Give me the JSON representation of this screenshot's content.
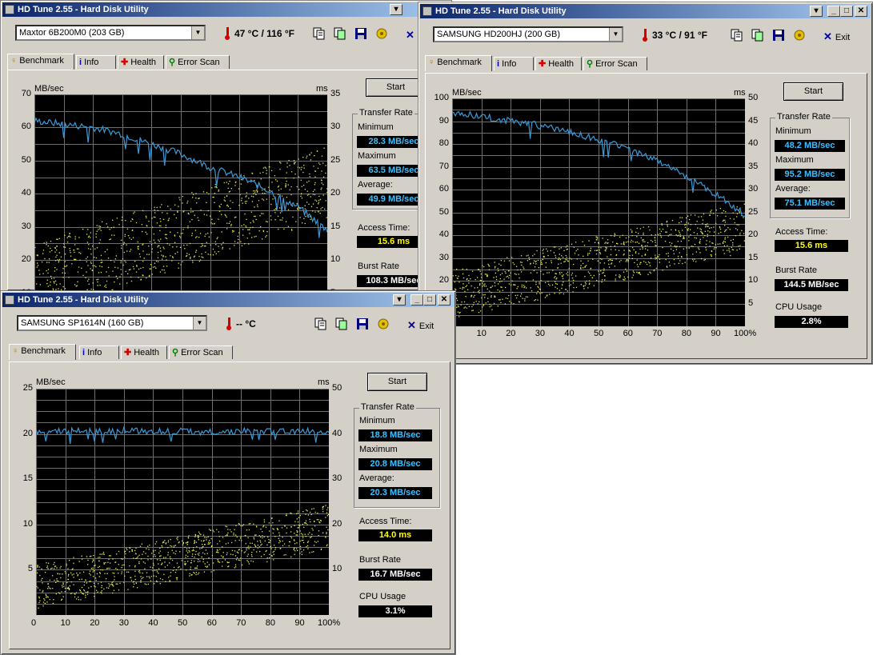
{
  "windows": [
    {
      "title": "HD Tune 2.55 - Hard Disk Utility",
      "drive": "Maxtor 6B200M0 (203 GB)",
      "temperature": "47 °C / 116 °F",
      "exit_label": "Exit",
      "tabs": [
        "Benchmark",
        "Info",
        "Health",
        "Error Scan"
      ],
      "start_label": "Start",
      "transfer_rate_label": "Transfer Rate",
      "minimum_label": "Minimum",
      "minimum": "28.3 MB/sec",
      "maximum_label": "Maximum",
      "maximum": "63.5 MB/sec",
      "average_label": "Average:",
      "average": "49.9 MB/sec",
      "access_time_label": "Access Time:",
      "access_time": "15.6 ms",
      "burst_rate_label": "Burst Rate",
      "burst_rate": "108.3 MB/sec",
      "y_unit_left": "MB/sec",
      "y_unit_right": "ms",
      "y_ticks_left": [
        "70",
        "60",
        "50",
        "40",
        "30",
        "20",
        "10"
      ],
      "y_ticks_right": [
        "35",
        "30",
        "25",
        "20",
        "15",
        "10",
        "5"
      ]
    },
    {
      "title": "HD Tune 2.55 - Hard Disk Utility",
      "drive": "SAMSUNG HD200HJ (200 GB)",
      "temperature": "33 °C / 91 °F",
      "exit_label": "Exit",
      "tabs": [
        "Benchmark",
        "Info",
        "Health",
        "Error Scan"
      ],
      "start_label": "Start",
      "transfer_rate_label": "Transfer Rate",
      "minimum_label": "Minimum",
      "minimum": "48.2 MB/sec",
      "maximum_label": "Maximum",
      "maximum": "95.2 MB/sec",
      "average_label": "Average:",
      "average": "75.1 MB/sec",
      "access_time_label": "Access Time:",
      "access_time": "15.6 ms",
      "burst_rate_label": "Burst Rate",
      "burst_rate": "144.5 MB/sec",
      "cpu_usage_label": "CPU Usage",
      "cpu_usage": "2.8%",
      "y_unit_left": "MB/sec",
      "y_unit_right": "ms",
      "y_ticks_left": [
        "100",
        "90",
        "80",
        "70",
        "60",
        "50",
        "40",
        "30",
        "20",
        "10"
      ],
      "y_ticks_right": [
        "50",
        "45",
        "40",
        "35",
        "30",
        "25",
        "20",
        "15",
        "10",
        "5"
      ],
      "x_ticks": [
        "10",
        "20",
        "30",
        "40",
        "50",
        "60",
        "70",
        "80",
        "90",
        "100%"
      ]
    },
    {
      "title": "HD Tune 2.55 - Hard Disk Utility",
      "drive": "SAMSUNG SP1614N (160 GB)",
      "temperature": "-- °C",
      "exit_label": "Exit",
      "tabs": [
        "Benchmark",
        "Info",
        "Health",
        "Error Scan"
      ],
      "start_label": "Start",
      "transfer_rate_label": "Transfer Rate",
      "minimum_label": "Minimum",
      "minimum": "18.8 MB/sec",
      "maximum_label": "Maximum",
      "maximum": "20.8 MB/sec",
      "average_label": "Average:",
      "average": "20.3 MB/sec",
      "access_time_label": "Access Time:",
      "access_time": "14.0 ms",
      "burst_rate_label": "Burst Rate",
      "burst_rate": "16.7 MB/sec",
      "cpu_usage_label": "CPU Usage",
      "cpu_usage": "3.1%",
      "y_unit_left": "MB/sec",
      "y_unit_right": "ms",
      "y_ticks_left": [
        "25",
        "20",
        "15",
        "10",
        "5"
      ],
      "y_ticks_right": [
        "50",
        "40",
        "30",
        "20",
        "10"
      ],
      "x_ticks": [
        "0",
        "10",
        "20",
        "30",
        "40",
        "50",
        "60",
        "70",
        "80",
        "90",
        "100%"
      ]
    }
  ],
  "chart_data": [
    {
      "type": "line",
      "drive": "Maxtor 6B200M0 (203 GB)",
      "y_unit_left": "MB/sec",
      "y_unit_right": "ms",
      "ylim_left": [
        0,
        70
      ],
      "ylim_right": [
        0,
        35
      ],
      "transfer_x": [
        0,
        10,
        20,
        30,
        40,
        50,
        60,
        70,
        80,
        90,
        100
      ],
      "transfer_y": [
        62,
        61,
        60,
        58,
        55,
        52,
        48,
        45,
        41,
        36,
        29
      ],
      "access_time_ms": 15.6,
      "grid": true
    },
    {
      "type": "line",
      "drive": "SAMSUNG HD200HJ (200 GB)",
      "y_unit_left": "MB/sec",
      "y_unit_right": "ms",
      "ylim_left": [
        0,
        100
      ],
      "ylim_right": [
        0,
        50
      ],
      "transfer_x": [
        0,
        10,
        20,
        30,
        40,
        50,
        60,
        70,
        80,
        90,
        100
      ],
      "transfer_y": [
        94,
        92,
        90,
        88,
        85,
        82,
        78,
        73,
        66,
        58,
        49
      ],
      "access_time_ms": 15.6,
      "grid": true
    },
    {
      "type": "line",
      "drive": "SAMSUNG SP1614N (160 GB)",
      "y_unit_left": "MB/sec",
      "y_unit_right": "ms",
      "ylim_left": [
        0,
        25
      ],
      "ylim_right": [
        0,
        50
      ],
      "transfer_x": [
        0,
        10,
        20,
        30,
        40,
        50,
        60,
        70,
        80,
        90,
        100
      ],
      "transfer_y": [
        20.3,
        20.3,
        20.3,
        20.4,
        20.3,
        20.3,
        20.2,
        20.3,
        20.3,
        20.3,
        20.3
      ],
      "access_time_ms": 14.0,
      "grid": true
    }
  ]
}
